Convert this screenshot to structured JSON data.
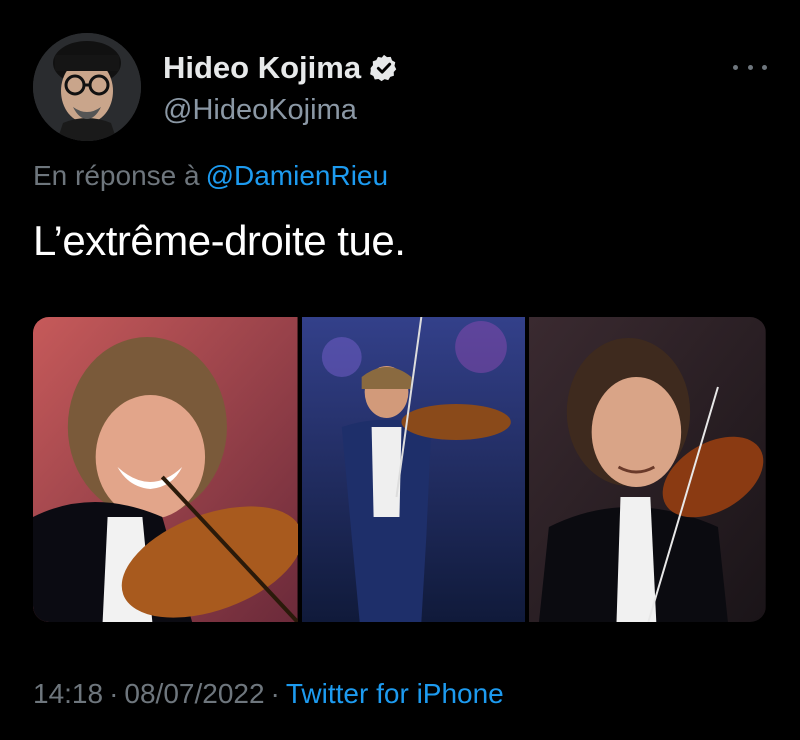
{
  "tweet": {
    "author": {
      "display_name": "Hideo Kojima",
      "handle": "@HideoKojima",
      "verified": true
    },
    "reply": {
      "prefix": "En réponse à",
      "mention": "@DamienRieu"
    },
    "text": "L’extrême-droite tue.",
    "media": [
      {
        "icon": "photo-violinist-laughing"
      },
      {
        "icon": "photo-violinist-stage"
      },
      {
        "icon": "photo-violinist-smiling"
      }
    ],
    "meta": {
      "time": "14:18",
      "separator": "·",
      "date": "08/07/2022",
      "source": "Twitter for iPhone"
    }
  },
  "colors": {
    "background": "#000000",
    "text": "#e7e9ea",
    "muted": "#6e767d",
    "accent": "#1d9bf0"
  }
}
